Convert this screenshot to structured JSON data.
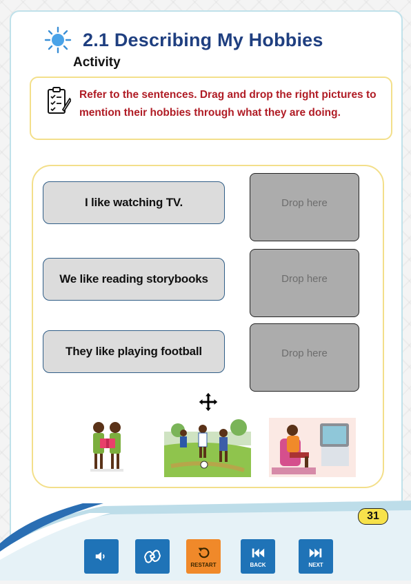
{
  "header": {
    "title": "2.1 Describing My Hobbies",
    "subtitle": "Activity",
    "icon": "sun-icon"
  },
  "instructions": {
    "icon": "checklist-icon",
    "text": "Refer to the sentences. Drag and drop the right pictures to mention their hobbies through what they are doing."
  },
  "sentences": [
    "I like watching TV.",
    "We like reading storybooks",
    "They like playing football"
  ],
  "drop_zones": [
    "Drop here",
    "Drop here",
    "Drop here"
  ],
  "pictures": [
    {
      "name": "children-reading-picture"
    },
    {
      "name": "children-playing-football-picture"
    },
    {
      "name": "person-watching-tv-picture"
    }
  ],
  "page_number": "31",
  "nav": {
    "audio": "",
    "sign_language": "",
    "restart": "RESTART",
    "back": "BACK",
    "next": "NEXT"
  },
  "colors": {
    "title": "#1f3f80",
    "instruction_text": "#b01c25",
    "frame_border": "#f3df8a",
    "button_blue": "#1f73b7",
    "restart_orange": "#f0892a",
    "page_badge": "#f7e24b"
  }
}
